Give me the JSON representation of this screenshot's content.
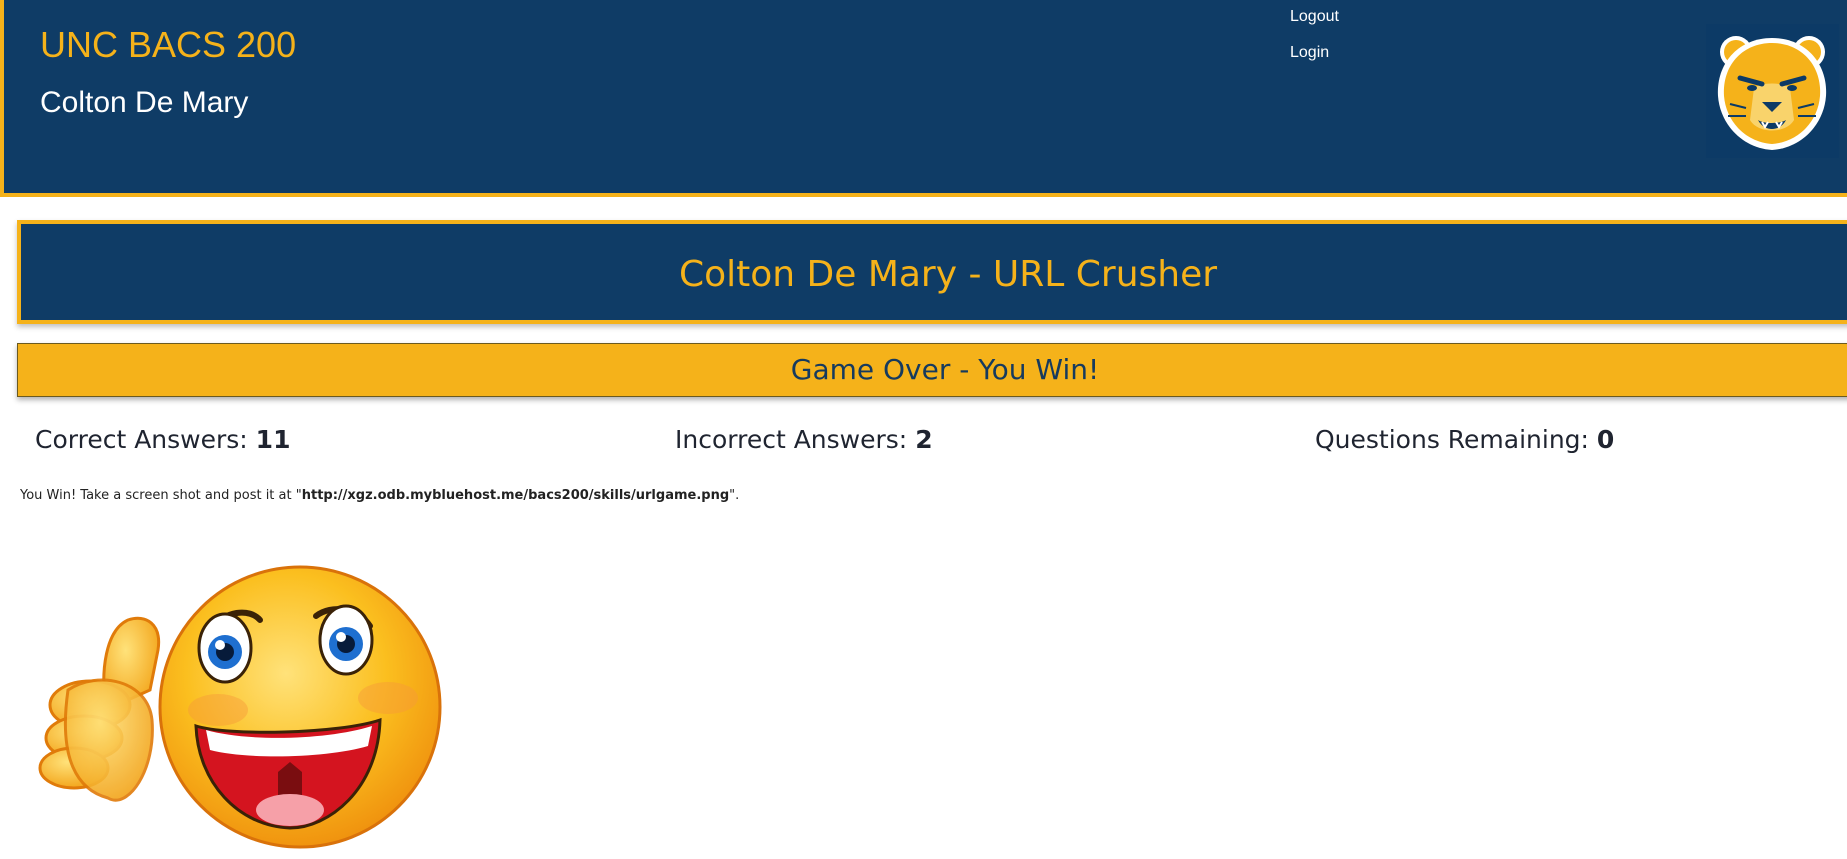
{
  "header": {
    "title": "UNC BACS 200",
    "subtitle": "Colton De Mary",
    "nav": {
      "logout": "Logout",
      "login": "Login"
    },
    "logo_icon": "bear-mascot-icon"
  },
  "game": {
    "title": "Colton De Mary - URL Crusher",
    "status": "Game Over - You Win!"
  },
  "stats": {
    "correct_label": "Correct Answers: ",
    "correct_value": "11",
    "incorrect_label": "Incorrect Answers: ",
    "incorrect_value": "2",
    "remaining_label": "Questions Remaining: ",
    "remaining_value": "0"
  },
  "message": {
    "prefix": "You Win! Take a screen shot and post it at \"",
    "url": "http://xgz.odb.mybluehost.me/bacs200/skills/urlgame.png",
    "suffix": "\"."
  },
  "image": {
    "icon": "thumbs-up-smiley-icon"
  },
  "colors": {
    "navy": "#0f3c66",
    "gold": "#f5b21a"
  }
}
